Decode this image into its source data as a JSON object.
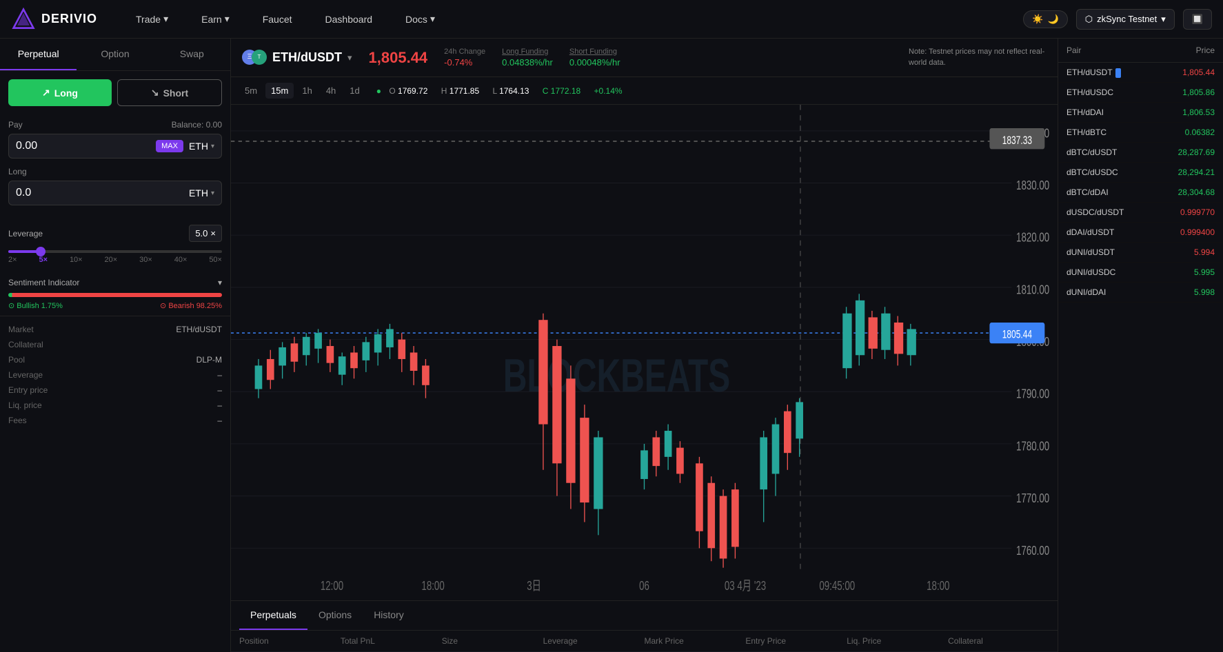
{
  "nav": {
    "logo": "DERIVIO",
    "items": [
      {
        "label": "Trade",
        "has_dropdown": true
      },
      {
        "label": "Earn",
        "has_dropdown": true
      },
      {
        "label": "Faucet",
        "has_dropdown": false
      },
      {
        "label": "Dashboard",
        "has_dropdown": false
      },
      {
        "label": "Docs",
        "has_dropdown": true
      }
    ],
    "network": "zkSync Testnet",
    "wallet_icon": "🔲"
  },
  "left_panel": {
    "tabs": [
      "Perpetual",
      "Option",
      "Swap"
    ],
    "active_tab": "Perpetual",
    "long_label": "Long",
    "short_label": "Short",
    "pay_label": "Pay",
    "balance_label": "Balance: 0.00",
    "pay_value": "0.00",
    "pay_token": "ETH",
    "max_label": "MAX",
    "long_label2": "Long",
    "long_value": "0.0",
    "long_token": "ETH",
    "leverage_label": "Leverage",
    "leverage_value": "5.0",
    "leverage_x": "×",
    "slider_marks": [
      "2×",
      "5×",
      "10×",
      "20×",
      "30×",
      "40×",
      "50×"
    ],
    "sentiment_label": "Sentiment Indicator",
    "bullish_pct": "1.75%",
    "bearish_pct": "98.25%",
    "bullish_label": "Bullish",
    "bearish_label": "Bearish",
    "info": {
      "market_label": "Market",
      "market_val": "ETH/dUSDT",
      "collateral_label": "Collateral",
      "collateral_val": "",
      "pool_label": "Pool",
      "pool_val": "DLP-M",
      "leverage_label": "Leverage",
      "leverage_val": "–",
      "entry_label": "Entry price",
      "entry_val": "–",
      "liq_label": "Liq. price",
      "liq_val": "–",
      "fees_label": "Fees",
      "fees_val": "–"
    }
  },
  "market_header": {
    "pair": "ETH/dUSDT",
    "price": "1,805.44",
    "change_label": "24h Change",
    "change_val": "-0.74%",
    "long_funding_label": "Long Funding",
    "long_funding_val": "0.04838%/hr",
    "short_funding_label": "Short Funding",
    "short_funding_val": "0.00048%/hr",
    "note": "Note: Testnet prices may not reflect real-world data."
  },
  "chart": {
    "timeframes": [
      "5m",
      "15m",
      "1h",
      "4h",
      "1d"
    ],
    "active_tf": "15m",
    "ohlc": {
      "o": "1769.72",
      "h": "1771.85",
      "l": "1764.13",
      "c": "1772.18",
      "change": "+0.14%"
    },
    "current_price": "1805.44",
    "price_levels": [
      "1840.00",
      "1830.00",
      "1820.00",
      "1810.00",
      "1800.00",
      "1790.00",
      "1780.00",
      "1770.00",
      "1760.00"
    ],
    "x_labels": [
      "12:00",
      "18:00",
      "3日",
      "06",
      "03 4月 '23",
      "09:45:00",
      "18:00"
    ],
    "watermark": "BLOCKBEATS",
    "dashed_price": "1837.33"
  },
  "bottom": {
    "tabs": [
      "Perpetuals",
      "Options",
      "History"
    ],
    "active_tab": "Perpetuals",
    "columns": [
      "Position",
      "Total PnL",
      "Size",
      "Leverage",
      "Mark Price",
      "Entry Price",
      "Liq. Price",
      "Collateral"
    ]
  },
  "right_panel": {
    "col_pair": "Pair",
    "col_price": "Price",
    "pairs": [
      {
        "name": "ETH/dUSDT",
        "price": "1,805.44",
        "color": "red",
        "badge": true
      },
      {
        "name": "ETH/dUSDC",
        "price": "1,805.86",
        "color": "green",
        "badge": false
      },
      {
        "name": "ETH/dDAI",
        "price": "1,806.53",
        "color": "green",
        "badge": false
      },
      {
        "name": "ETH/dBTC",
        "price": "0.06382",
        "color": "green",
        "badge": false
      },
      {
        "name": "dBTC/dUSDT",
        "price": "28,287.69",
        "color": "green",
        "badge": false
      },
      {
        "name": "dBTC/dUSDC",
        "price": "28,294.21",
        "color": "green",
        "badge": false
      },
      {
        "name": "dBTC/dDAI",
        "price": "28,304.68",
        "color": "green",
        "badge": false
      },
      {
        "name": "dUSDC/dUSDT",
        "price": "0.999770",
        "color": "red",
        "badge": false
      },
      {
        "name": "dDAI/dUSDT",
        "price": "0.999400",
        "color": "red",
        "badge": false
      },
      {
        "name": "dUNI/dUSDT",
        "price": "5.994",
        "color": "red",
        "badge": false
      },
      {
        "name": "dUNI/dUSDC",
        "price": "5.995",
        "color": "green",
        "badge": false
      },
      {
        "name": "dUNI/dDAI",
        "price": "5.998",
        "color": "green",
        "badge": false
      }
    ]
  }
}
